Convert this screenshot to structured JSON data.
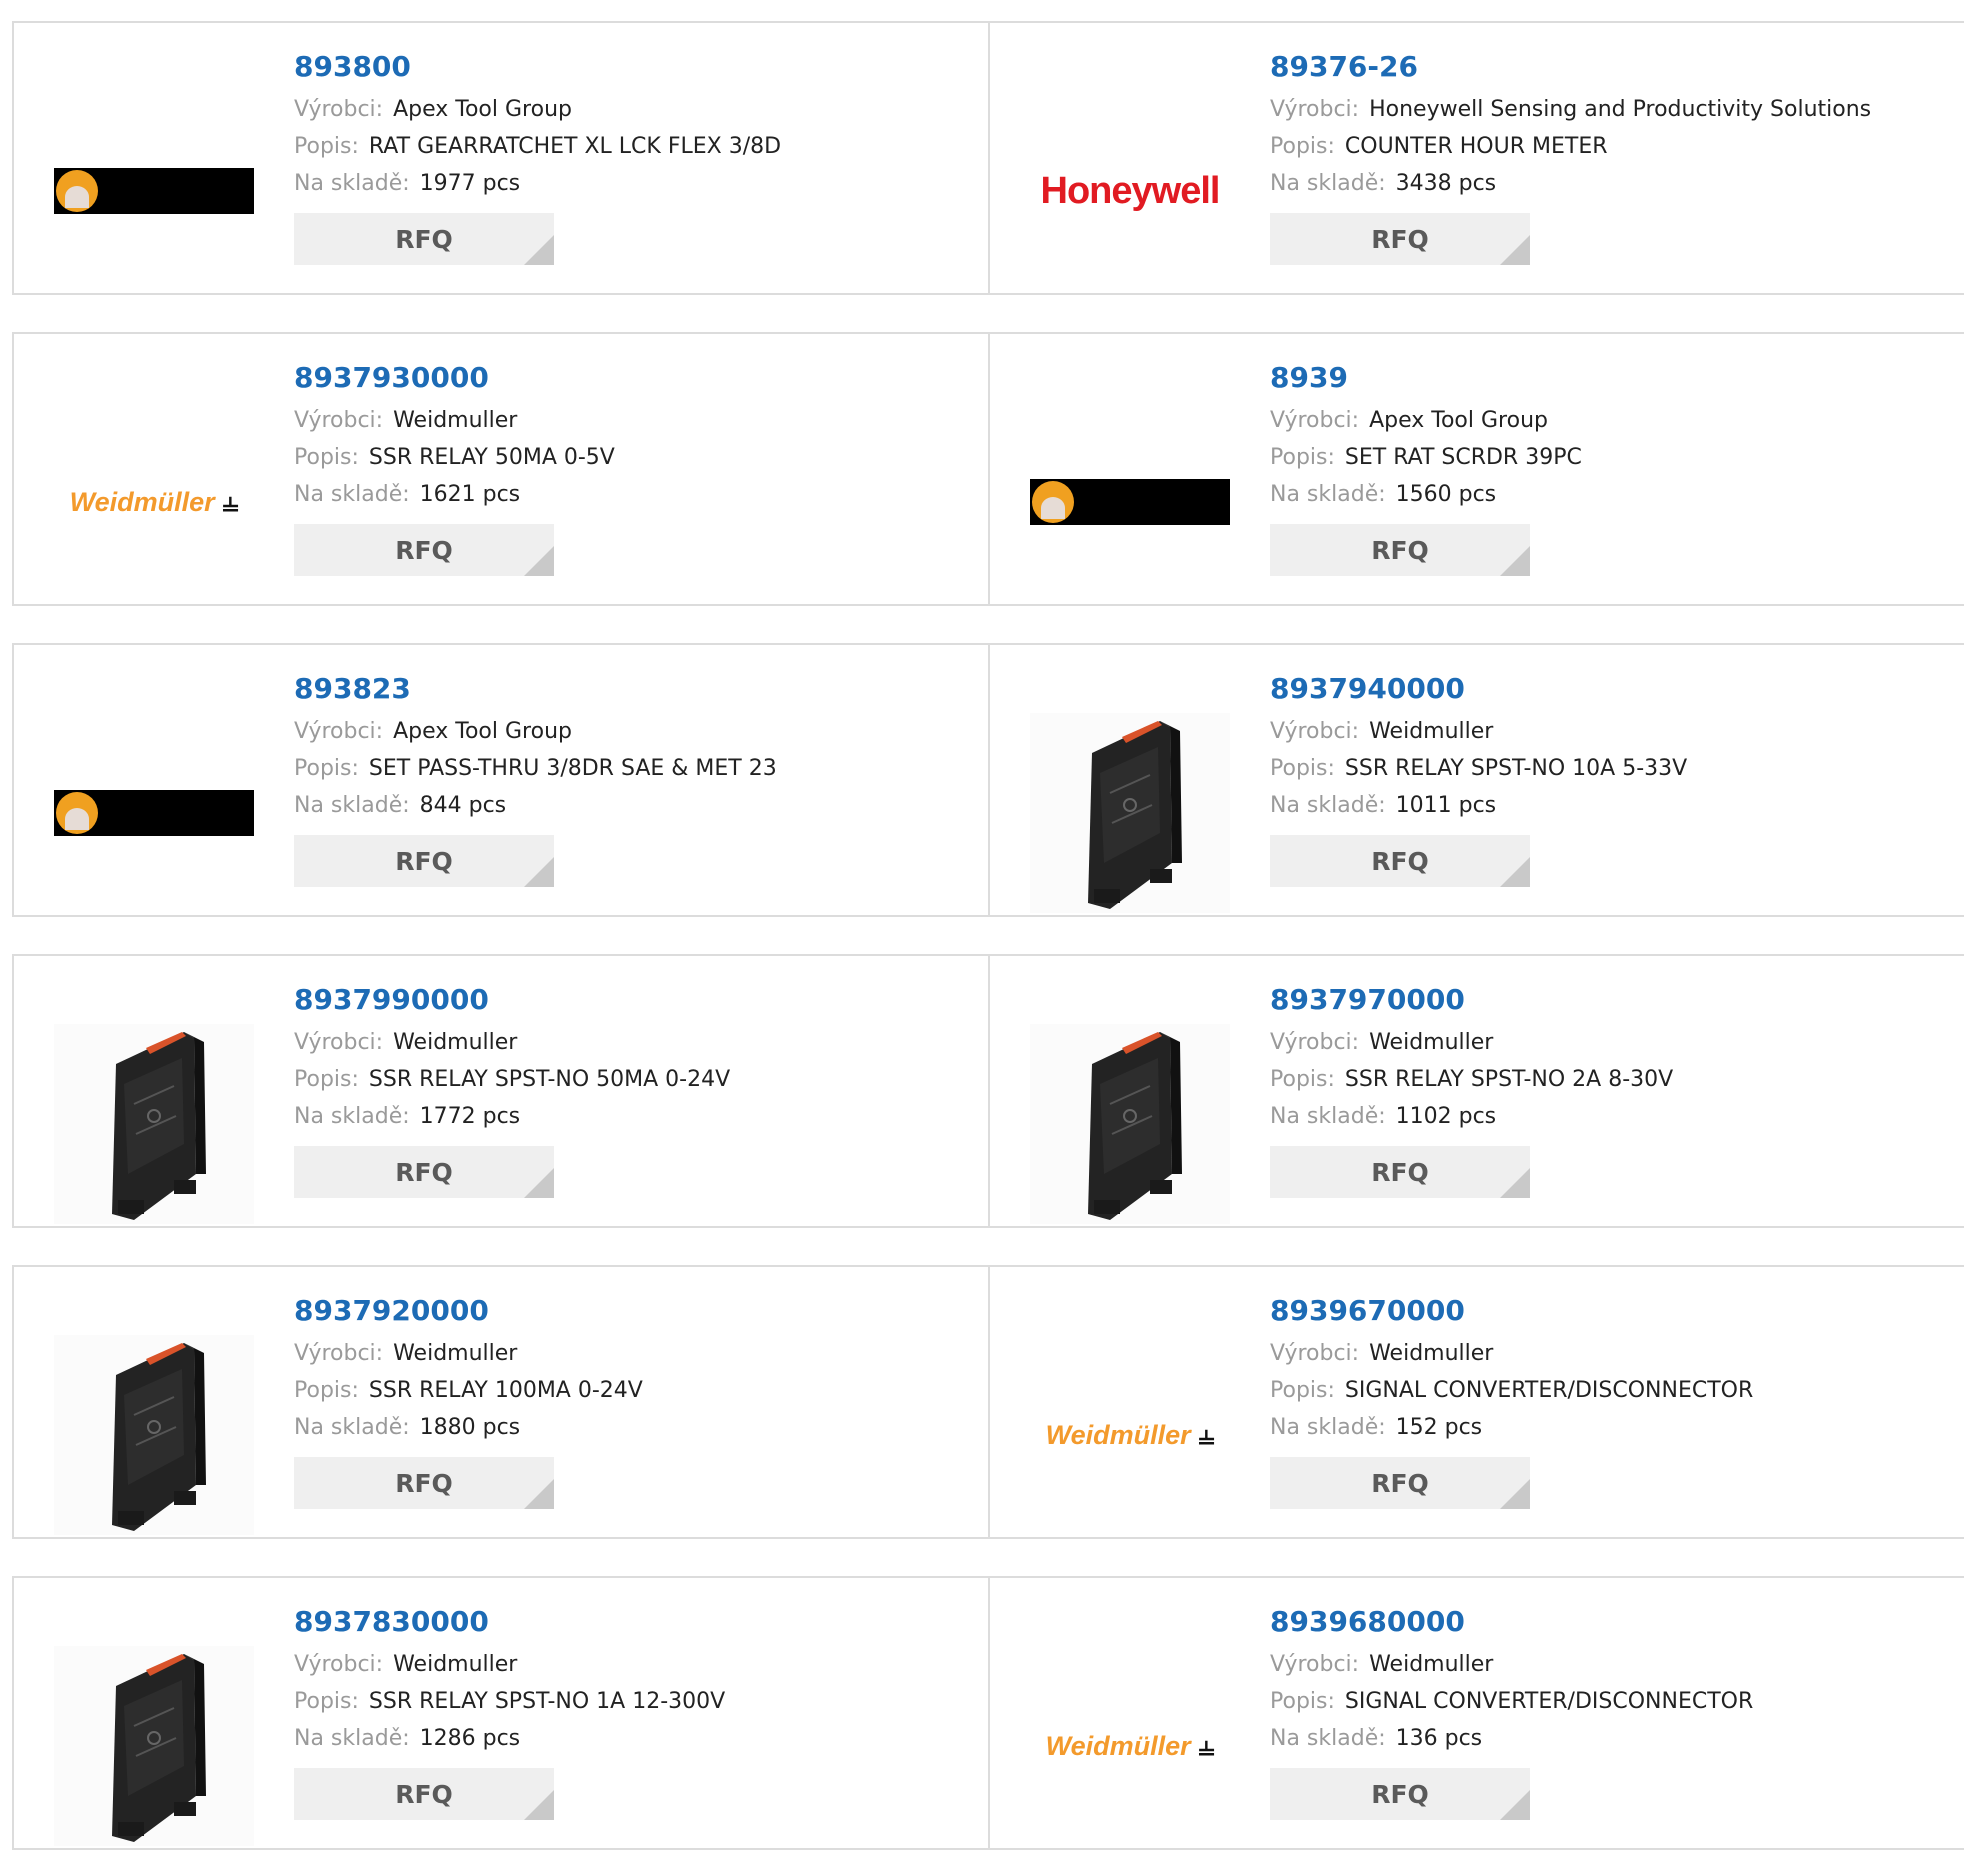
{
  "labels": {
    "manufacturer": "Výrobci:",
    "description": "Popis:",
    "stock": "Na skladě:",
    "rfq": "RFQ"
  },
  "rows": [
    [
      {
        "pn": "893800",
        "manufacturer": "Apex Tool Group",
        "description": "RAT GEARRATCHET XL LCK FLEX 3/8D",
        "stock": "1977 pcs",
        "image": "apex-logo"
      },
      {
        "pn": "89376-26",
        "manufacturer": "Honeywell Sensing and Productivity Solutions",
        "description": "COUNTER HOUR METER",
        "stock": "3438 pcs",
        "image": "honeywell-logo",
        "logo_text": "Honeywell"
      }
    ],
    [
      {
        "pn": "8937930000",
        "manufacturer": "Weidmuller",
        "description": "SSR RELAY 50MA 0-5V",
        "stock": "1621 pcs",
        "image": "weidmuller-logo",
        "logo_text": "Weidmüller"
      },
      {
        "pn": "8939",
        "manufacturer": "Apex Tool Group",
        "description": "SET RAT SCRDR 39PC",
        "stock": "1560 pcs",
        "image": "apex-logo"
      }
    ],
    [
      {
        "pn": "893823",
        "manufacturer": "Apex Tool Group",
        "description": "SET PASS-THRU 3/8DR SAE & MET 23",
        "stock": "844 pcs",
        "image": "apex-logo"
      },
      {
        "pn": "8937940000",
        "manufacturer": "Weidmuller",
        "description": "SSR RELAY SPST-NO 10A 5-33V",
        "stock": "1011 pcs",
        "image": "relay-photo"
      }
    ],
    [
      {
        "pn": "8937990000",
        "manufacturer": "Weidmuller",
        "description": "SSR RELAY SPST-NO 50MA 0-24V",
        "stock": "1772 pcs",
        "image": "relay-photo"
      },
      {
        "pn": "8937970000",
        "manufacturer": "Weidmuller",
        "description": "SSR RELAY SPST-NO 2A 8-30V",
        "stock": "1102 pcs",
        "image": "relay-photo"
      }
    ],
    [
      {
        "pn": "8937920000",
        "manufacturer": "Weidmuller",
        "description": "SSR RELAY 100MA 0-24V",
        "stock": "1880 pcs",
        "image": "relay-photo"
      },
      {
        "pn": "8939670000",
        "manufacturer": "Weidmuller",
        "description": "SIGNAL CONVERTER/DISCONNECTOR",
        "stock": "152 pcs",
        "image": "weidmuller-logo",
        "logo_text": "Weidmüller"
      }
    ],
    [
      {
        "pn": "8937830000",
        "manufacturer": "Weidmuller",
        "description": "SSR RELAY SPST-NO 1A 12-300V",
        "stock": "1286 pcs",
        "image": "relay-photo"
      },
      {
        "pn": "8939680000",
        "manufacturer": "Weidmuller",
        "description": "SIGNAL CONVERTER/DISCONNECTOR",
        "stock": "136 pcs",
        "image": "weidmuller-logo",
        "logo_text": "Weidmüller"
      }
    ]
  ],
  "colors": {
    "link": "#1d6bb5",
    "label": "#9a9a9a",
    "border": "#dcdcdc",
    "button_bg": "#efefef"
  }
}
